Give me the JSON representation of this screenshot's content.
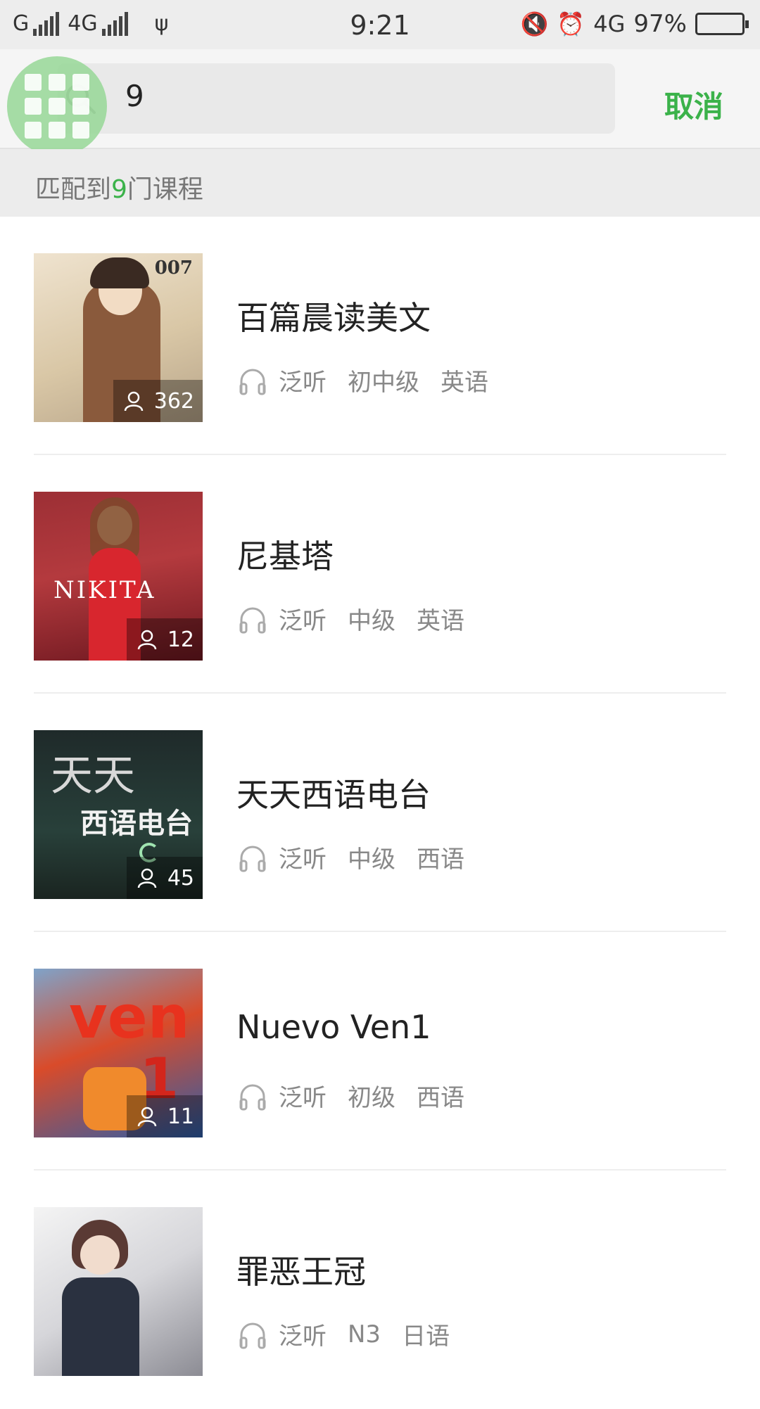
{
  "status_bar": {
    "carrier": "G",
    "network": "4G",
    "time": "9:21",
    "network_right": "4G",
    "battery": "97%"
  },
  "search": {
    "value": "9",
    "cancel_label": "取消"
  },
  "result_summary": {
    "prefix": "匹配到",
    "count": "9",
    "suffix": "门课程"
  },
  "courses": [
    {
      "title": "百篇晨读美文",
      "learners": "362",
      "tags": [
        "泛听",
        "初中级",
        "英语"
      ],
      "cover_text": "007"
    },
    {
      "title": "尼基塔",
      "learners": "12",
      "tags": [
        "泛听",
        "中级",
        "英语"
      ],
      "cover_text": "NIKITA"
    },
    {
      "title": "天天西语电台",
      "learners": "45",
      "tags": [
        "泛听",
        "中级",
        "西语"
      ],
      "cover_text": "天天",
      "cover_text_2": "西语电台"
    },
    {
      "title": "Nuevo Ven1",
      "learners": "11",
      "tags": [
        "泛听",
        "初级",
        "西语"
      ],
      "cover_text": "ven"
    },
    {
      "title": "罪恶王冠",
      "learners": "",
      "tags": [
        "泛听",
        "N3",
        "日语"
      ],
      "cover_text": ""
    }
  ],
  "colors": {
    "accent": "#3bb24a",
    "tag_text": "#888888"
  },
  "icons": {
    "headphone": "headphone-icon",
    "person": "person-icon",
    "search": "search-icon",
    "grid": "grid-icon"
  }
}
